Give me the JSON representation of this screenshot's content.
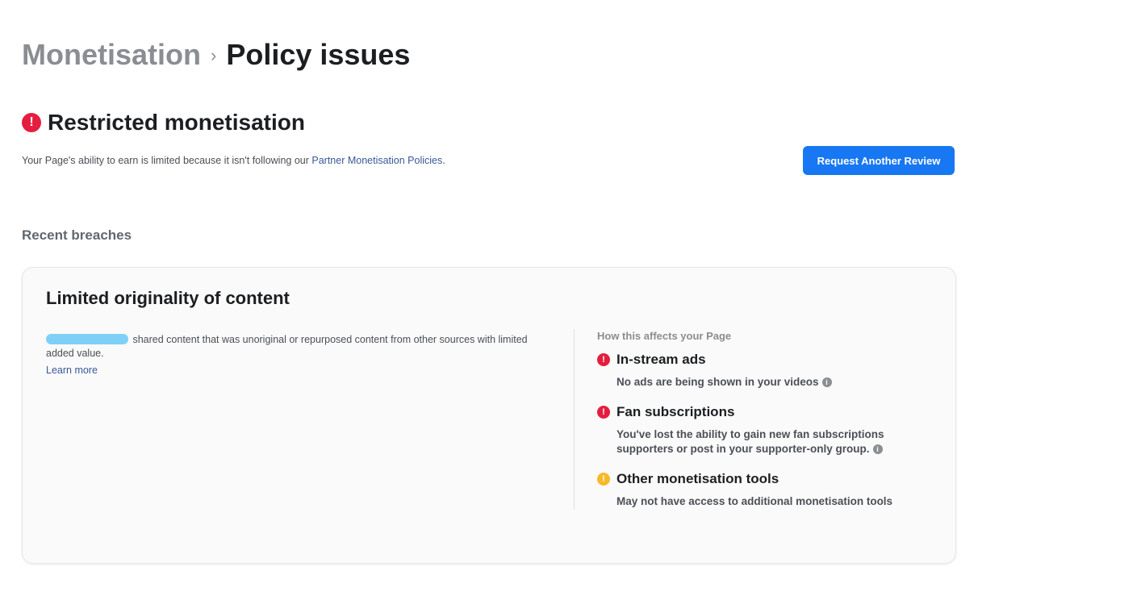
{
  "breadcrumb": {
    "parent": "Monetisation",
    "separator": "›",
    "current": "Policy issues"
  },
  "status": {
    "icon": "alert-icon",
    "icon_glyph": "!",
    "title": "Restricted monetisation",
    "description_prefix": "Your Page's ability to earn is limited because it isn't following our ",
    "policy_link": "Partner Monetisation Policies",
    "description_suffix": "."
  },
  "review_button": {
    "label": "Request Another Review",
    "color": "#1877f2"
  },
  "recent_breaches": {
    "title": "Recent breaches",
    "items": [
      {
        "title": "Limited originality of content",
        "description": " shared content that was unoriginal or repurposed content from other sources with limited added value.",
        "learn_more": "Learn more",
        "effects_heading": "How this affects your Page",
        "effects": [
          {
            "icon": "alert-icon",
            "severity": "error",
            "title": "In-stream ads",
            "description": "No ads are being shown in your videos",
            "info_icon": true
          },
          {
            "icon": "alert-icon",
            "severity": "error",
            "title": "Fan subscriptions",
            "description": "You've lost the ability to gain new fan subscriptions supporters or post in your supporter-only group.",
            "info_icon": true
          },
          {
            "icon": "warning-icon",
            "severity": "warning",
            "title": "Other monetisation tools",
            "description": "May not have access to additional monetisation tools",
            "info_icon": false
          }
        ]
      }
    ]
  },
  "colors": {
    "error": "#e41e3f",
    "warning": "#f7b928",
    "link": "#385898",
    "redaction": "#7fd0f7"
  }
}
